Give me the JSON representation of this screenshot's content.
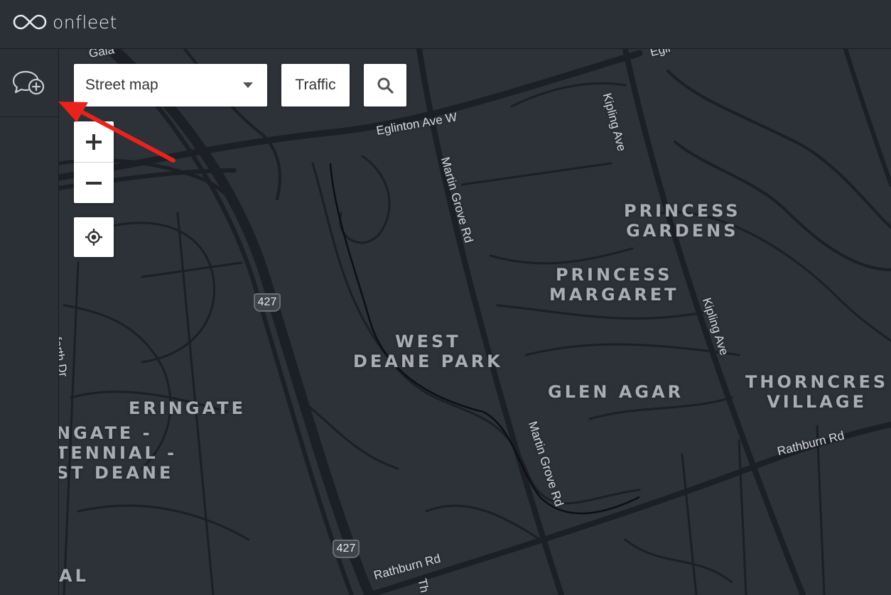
{
  "app": {
    "brand": "onfleet",
    "logo_icon": "infinity-logo-icon"
  },
  "sidebar": {
    "items": [
      {
        "icon": "chat-add-icon"
      }
    ]
  },
  "map_controls": {
    "map_type": {
      "selected": "Street map",
      "icon": "caret-down-icon"
    },
    "traffic_label": "Traffic",
    "search_icon": "search-icon",
    "zoom_in_icon": "plus-icon",
    "zoom_out_icon": "minus-icon",
    "locate_icon": "crosshair-icon"
  },
  "map": {
    "street_labels": {
      "eglinton": "Eglinton Ave W",
      "kipling_top": "Kipling Ave",
      "kipling_mid": "Kipling Ave",
      "martin_top": "Martin Grove Rd",
      "martin_bottom": "Martin Grove Rd",
      "rathburn_right": "Rathburn Rd",
      "rathburn_bottom": "Rathburn Rd",
      "galaxy": "Gala",
      "eglin_top": "Egli",
      "forth": "forth Dr",
      "th": "Th"
    },
    "area_labels": {
      "princess_gardens": "PRINCESS\nGARDENS",
      "princess_margaret": "PRINCESS\nMARGARET",
      "west_deane_park": "WEST\nDEANE PARK",
      "glen_agar": "GLEN AGAR",
      "thorncrest": "THORNCRES\nVILLAGE",
      "eringate": "ERINGATE",
      "eringate_centennial": "NGATE -\nTENNIAL -\nST DEANE",
      "al": "AL"
    },
    "highway_shields": {
      "top": "427",
      "bottom": "427"
    }
  },
  "colors": {
    "map_bg": "#2d3138",
    "roads": "#1c1f24",
    "annotation_arrow": "#e8231c"
  }
}
